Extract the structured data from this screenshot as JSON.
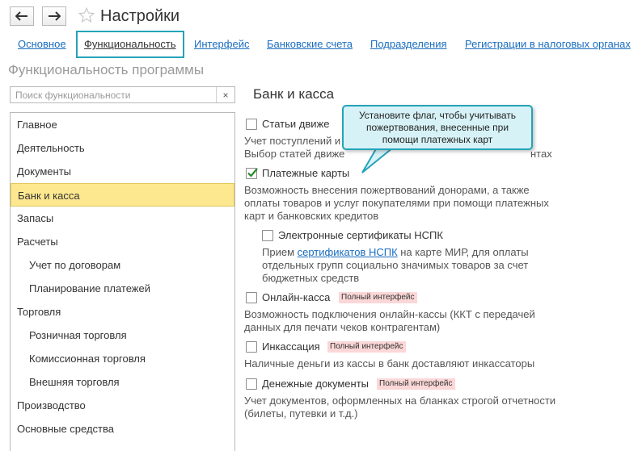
{
  "window": {
    "title": "Настройки"
  },
  "tabs": [
    {
      "label": "Основное"
    },
    {
      "label": "Функциональность",
      "active": true
    },
    {
      "label": "Интерфейс"
    },
    {
      "label": "Банковские счета"
    },
    {
      "label": "Подразделения"
    },
    {
      "label": "Регистрации в налоговых органах"
    }
  ],
  "section_title": "Функциональность программы",
  "search": {
    "placeholder": "Поиск функциональности",
    "value": "",
    "clear_glyph": "×"
  },
  "nav": {
    "items": [
      {
        "label": "Главное",
        "level": 0
      },
      {
        "label": "Деятельность",
        "level": 0
      },
      {
        "label": "Документы",
        "level": 0
      },
      {
        "label": "Банк и касса",
        "level": 0,
        "selected": true
      },
      {
        "label": "Запасы",
        "level": 0
      },
      {
        "label": "Расчеты",
        "level": 0
      },
      {
        "label": "Учет по договорам",
        "level": 1
      },
      {
        "label": "Планирование платежей",
        "level": 1
      },
      {
        "label": "Торговля",
        "level": 0
      },
      {
        "label": "Розничная торговля",
        "level": 1
      },
      {
        "label": "Комиссионная торговля",
        "level": 1
      },
      {
        "label": "Внешняя торговля",
        "level": 1
      },
      {
        "label": "Производство",
        "level": 0
      },
      {
        "label": "Основные средства",
        "level": 0
      }
    ]
  },
  "panel": {
    "title": "Банк и касса",
    "options": {
      "cash_flow": {
        "label": "Статьи движе",
        "checked": false,
        "desc_line1": "Учет поступлений и",
        "desc_line2": "Выбор статей движе",
        "desc_tail": "нтах"
      },
      "payment_cards": {
        "label": "Платежные карты",
        "checked": true,
        "desc": "Возможность внесения пожертвований донорами, а также оплаты товаров и услуг покупателями при помощи платежных карт и банковских кредитов"
      },
      "nspk": {
        "label": "Электронные сертификаты НСПК",
        "checked": false,
        "desc_prefix": "Прием ",
        "desc_link": "сертификатов НСПК",
        "desc_suffix": " на карте МИР, для оплаты отдельных групп социально значимых товаров за счет бюджетных средств"
      },
      "online_cash": {
        "label": "Онлайн-касса",
        "checked": false,
        "badge": "Полный интерфейс",
        "desc": "Возможность подключения онлайн-кассы (ККТ с передачей данных для печати чеков контрагентам)"
      },
      "collection": {
        "label": "Инкассация",
        "checked": false,
        "badge": "Полный интерфейс",
        "desc": "Наличные деньги из кассы в банк доставляют инкассаторы"
      },
      "money_docs": {
        "label": "Денежные документы",
        "checked": false,
        "badge": "Полный интерфейс",
        "desc": "Учет документов, оформленных на бланках строгой отчетности (билеты, путевки и т.д.)"
      }
    }
  },
  "callout": {
    "line1": "Установите флаг, чтобы учитывать",
    "line2": "пожертвования, внесенные при",
    "line3": "помощи платежных карт"
  },
  "colors": {
    "accent": "#25a3b8",
    "link": "#1a6dbf",
    "selection": "#fde88f",
    "badge": "#fbd7d7",
    "callout_bg": "#d7f2f6"
  }
}
